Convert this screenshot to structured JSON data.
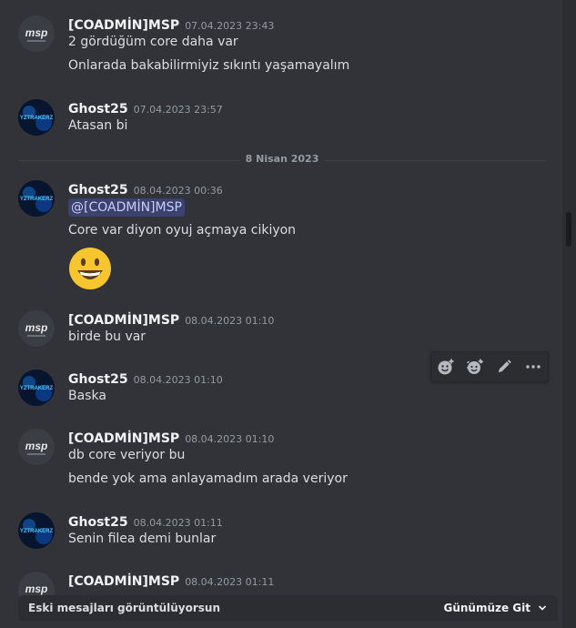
{
  "divider": {
    "label": "8 Nisan 2023"
  },
  "messages": [
    {
      "author": "[COADMİN]MSP",
      "time": "07.04.2023 23:43",
      "lines": [
        "2 gördüğüm core daha var",
        "Onlarada bakabilirmiyiz sıkıntı yaşamayalım"
      ]
    },
    {
      "author": "Ghost25",
      "time": "07.04.2023 23:57",
      "lines": [
        "Atasan bi"
      ]
    },
    {
      "author": "Ghost25",
      "time": "08.04.2023 00:36",
      "mention": "@[COADMİN]MSP",
      "lines": [
        "Core var diyon oyuj açmaya cikiyon"
      ],
      "emoji": "grinning-face"
    },
    {
      "author": "[COADMİN]MSP",
      "time": "08.04.2023 01:10",
      "lines": [
        "birde bu var"
      ]
    },
    {
      "author": "Ghost25",
      "time": "08.04.2023 01:10",
      "lines": [
        "Baska"
      ]
    },
    {
      "author": "[COADMİN]MSP",
      "time": "08.04.2023 01:10",
      "lines": [
        "db core veriyor bu",
        "bende yok ama anlayamadım arada veriyor"
      ]
    },
    {
      "author": "Ghost25",
      "time": "08.04.2023 01:11",
      "lines": [
        "Senin filea demi bunlar"
      ]
    },
    {
      "author": "[COADMİN]MSP",
      "time": "08.04.2023 01:11",
      "lines": []
    }
  ],
  "avatar_text": {
    "msp": "msp",
    "ghost": "YZTRAKERZ"
  },
  "toolbar": {
    "icons": [
      "add-reaction-icon",
      "super-reaction-icon",
      "edit-pencil-icon",
      "more-options-icon"
    ]
  },
  "jump_bar": {
    "label": "Eski mesajları görüntülüyorsun",
    "button": "Günümüze Git"
  },
  "colors": {
    "background": "#313338",
    "mention_bg": "#3c4270",
    "mention_text": "#c9cdfb",
    "emoji": "#f7c52d"
  }
}
